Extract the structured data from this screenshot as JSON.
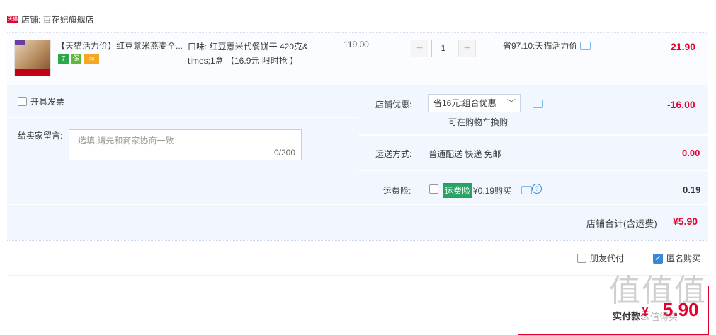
{
  "shop": {
    "badge": "天猫",
    "label": "店铺: 百花妃旗舰店"
  },
  "item": {
    "title": "【天猫活力价】红豆薏米燕麦全...",
    "icons": [
      "seven-day-return-icon",
      "consumer-guarantee-icon",
      "credit-card-icon"
    ],
    "icon_labels": {
      "seven": "7",
      "guarantee": "保"
    },
    "spec_line1": "口味: 红豆薏米代餐饼干 420克&",
    "spec_line2": "times;1盒 【16.9元 限时抢 】",
    "price": "119.00",
    "quantity": "1",
    "minus": "−",
    "plus": "+",
    "promo": "省97.10:天猫活力价",
    "total": "21.90"
  },
  "invoice": {
    "label": "开具发票"
  },
  "message": {
    "label": "给卖家留言:",
    "placeholder": "选填,请先和商家协商一致",
    "count": "0/200"
  },
  "discount": {
    "label": "店铺优惠:",
    "selected": "省16元:组合优惠",
    "chevron": "﹀",
    "note": "可在购物车换购",
    "value": "-16.00"
  },
  "shipping": {
    "label": "运送方式:",
    "value": "普通配送 快递 免邮",
    "fee": "0.00"
  },
  "insurance": {
    "label": "运费险:",
    "tag": "运费险",
    "price": "¥0.19购买",
    "help": "?",
    "value": "0.19"
  },
  "subtotal": {
    "label": "店铺合计(含运费)",
    "value": "¥5.90"
  },
  "options": {
    "friend_pay": "朋友代付",
    "anonymous": "匿名购买",
    "check": "✓"
  },
  "payment": {
    "label": "实付款:",
    "yen": "¥",
    "value": "5.90"
  },
  "watermark": {
    "main": "值值值",
    "sub": "什么值得买"
  },
  "colors": {
    "accent_red": "#e5002d",
    "row_bg": "#fbfcff",
    "panel_bg": "#f2f7ff",
    "check_blue": "#3a86d9"
  }
}
